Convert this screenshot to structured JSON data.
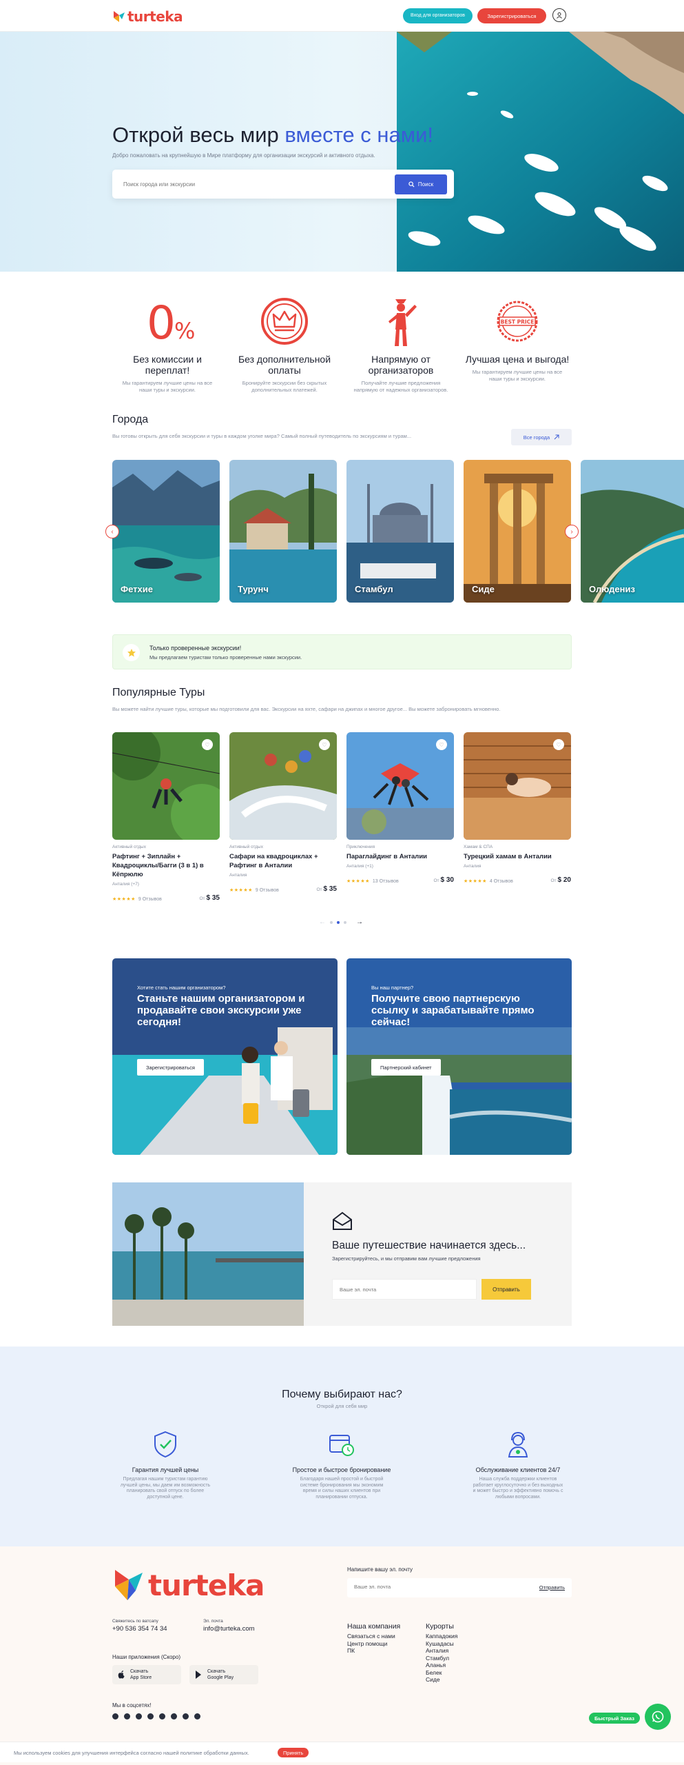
{
  "header": {
    "logo": "turteka",
    "organizer_login": "Вход для организаторов",
    "register": "Зарегистрироваться"
  },
  "hero": {
    "title_main": "Открой весь мир ",
    "title_accent": "вместе с нами!",
    "subtitle": "Добро пожаловать на крупнейшую в Мире платформу для организации экскурсий и активного отдыха.",
    "search_placeholder": "Поиск города или экскурсии",
    "search_button": "Поиск"
  },
  "features": [
    {
      "icon": "zero-percent-icon",
      "title": "Без комиссии и переплат!",
      "desc": "Мы гарантируем лучшие цены на все наши туры и экскурсии."
    },
    {
      "icon": "crown-icon",
      "title": "Без дополнительной оплаты",
      "desc": "Бронируйте экскурсии без скрытых дополнительных платежей."
    },
    {
      "icon": "organizer-icon",
      "title": "Напрямую от организаторов",
      "desc": "Получайте лучшие предложения напрямую от надежных организаторов."
    },
    {
      "icon": "best-price-icon",
      "title": "Лучшая цена и выгода!",
      "desc": "Мы гарантируем лучшие цены на все наши туры и экскурсии."
    }
  ],
  "cities": {
    "title": "Города",
    "subtitle": "Вы готовы открыть для себя экскурсии и туры в каждом уголке мира? Самый полный путеводитель по экскурсиям и турам...",
    "all_button": "Все города",
    "items": [
      {
        "name": "Фетхие"
      },
      {
        "name": "Турунч"
      },
      {
        "name": "Стамбул"
      },
      {
        "name": "Сиде"
      },
      {
        "name": "Олюдениз"
      }
    ]
  },
  "verified": {
    "title": "Только проверенные экскурсии!",
    "subtitle": "Мы предлагаем туристам только проверенные нами экскурсии."
  },
  "tours": {
    "title": "Популярные Туры",
    "subtitle": "Вы можете найти лучшие туры, которые мы подготовили для вас. Экскурсии на яхте, сафари на джипах и многое другое... Вы можете забронировать мгновенно.",
    "price_prefix": "От",
    "items": [
      {
        "category": "Активный отдых",
        "title": "Рафтинг + Зиплайн + Квадроциклы/Багги (3 в 1) в Кёпрюлю",
        "location": "Анталия (+7)",
        "reviews": "9 Отзывов",
        "price": "$ 35"
      },
      {
        "category": "Активный отдых",
        "title": "Сафари на квадроциклах + Рафтинг в Анталии",
        "location": "Анталия",
        "reviews": "9 Отзывов",
        "price": "$ 35"
      },
      {
        "category": "Приключения",
        "title": "Параглайдинг в Анталии",
        "location": "Анталия (+1)",
        "reviews": "13 Отзывов",
        "price": "$ 30"
      },
      {
        "category": "Хамам & СПА",
        "title": "Турецкий хамам в Анталии",
        "location": "Анталия",
        "reviews": "4 Отзывов",
        "price": "$ 20"
      }
    ]
  },
  "promos": [
    {
      "question": "Хотите стать нашим организатором?",
      "heading": "Станьте нашим организатором и продавайте свои экскурсии уже сегодня!",
      "button": "Зарегистрироваться"
    },
    {
      "question": "Вы наш партнер?",
      "heading": "Получите свою партнерскую ссылку и зарабатывайте прямо сейчас!",
      "button": "Партнерский кабинет"
    }
  ],
  "newsletter": {
    "title": "Ваше путешествие начинается здесь...",
    "subtitle": "Зарегистрируйтесь, и мы отправим вам лучшие предложения",
    "placeholder": "Ваше эл. почта",
    "button": "Отправить"
  },
  "why": {
    "title": "Почему выбирают нас?",
    "subtitle": "Открой для себя мир",
    "items": [
      {
        "title": "Гарантия лучшей цены",
        "desc": "Предлагая нашим туристам гарантию лучшей цены, мы даем им возможность планировать свой отпуск по более доступной цене."
      },
      {
        "title": "Простое и быстрое бронирование",
        "desc": "Благодаря нашей простой и быстрой системе бронирования мы экономим время и силы наших клиентов при планировании отпуска."
      },
      {
        "title": "Обслуживание клиентов 24/7",
        "desc": "Наша служба поддержки клиентов работает круглосуточно и без выходных и может быстро и эффективно помочь с любыми вопросами."
      }
    ]
  },
  "footer": {
    "logo": "turteka",
    "whatsapp_label": "Свяжитесь по ватсапу",
    "whatsapp_value": "+90 536 354 74 34",
    "email_label": "Эл. почта",
    "email_value": "info@turteka.com",
    "apps_label": "Наши приложения (Скоро)",
    "app_store": {
      "small": "Скачать",
      "name": "App Store"
    },
    "google_play": {
      "small": "Скачать",
      "name": "Google Play"
    },
    "social_label": "Мы в соцсетях!",
    "email_form_label": "Напишите вашу эл. почту",
    "email_form_placeholder": "Ваше эл. почта",
    "email_form_button": "Отправить",
    "company_title": "Наша компания",
    "company_links": [
      "Связаться с нами",
      "Центр помощи",
      "ПК"
    ],
    "resorts_title": "Курорты",
    "resorts_links": [
      "Каппадокия",
      "Кушадасы",
      "Анталия",
      "Стамбул",
      "Аланья",
      "Белек",
      "Сиде"
    ]
  },
  "fast_order": "Быстрый Заказ",
  "cookie": {
    "text": "Мы используем cookies для улучшения интерфейса согласно нашей политике обработки данных.",
    "button": "Принять"
  }
}
